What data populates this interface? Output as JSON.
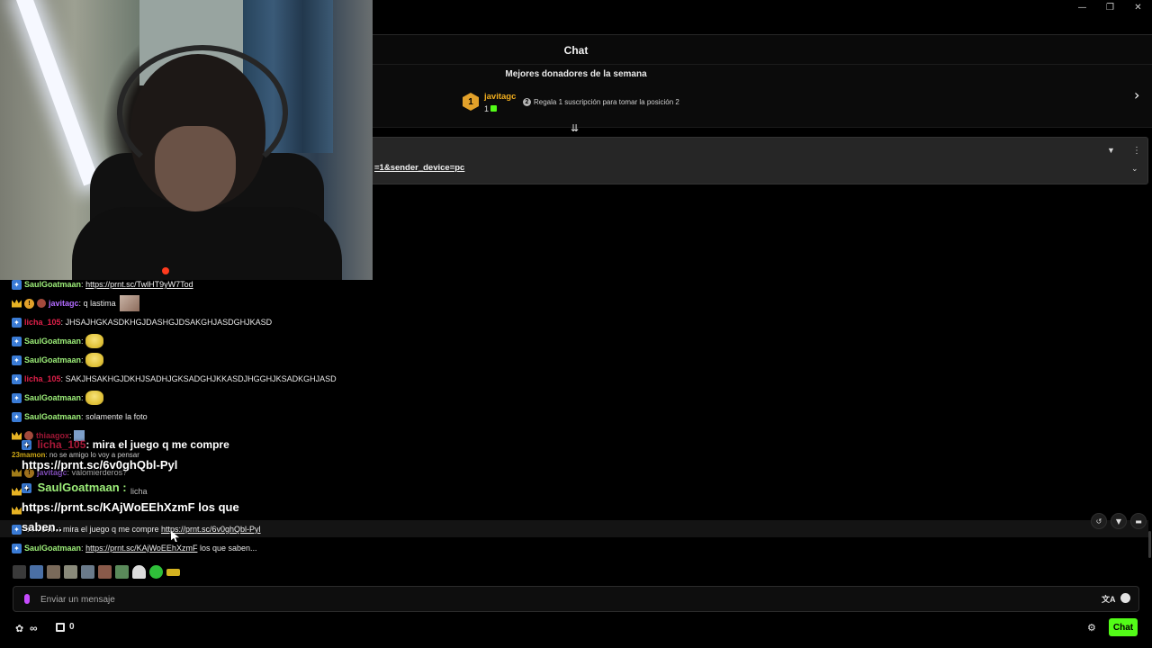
{
  "window": {
    "minimize": "—",
    "restore": "❐",
    "close": "✕"
  },
  "header": {
    "title": "Chat"
  },
  "donors": {
    "title": "Mejores donadores de la semana",
    "top": {
      "rank": "1",
      "name": "javitagc",
      "count": "1"
    },
    "cta_icon": "2",
    "cta": "Regala 1 suscripción para tomar la posición 2"
  },
  "pinned": {
    "link": "=1&sender_device=pc"
  },
  "messages": [
    {
      "user": "SaulGoatmaan",
      "sep": ":",
      "link": "https://prnt.sc/TwlHT9yW7Tod"
    },
    {
      "user": "javitagc",
      "sep": ":",
      "text": "q lastima"
    },
    {
      "user": "licha_105",
      "sep": ":",
      "text": "JHSAJHGKASDKHGJDASHGJDSAKGHJASDGHJKASD"
    },
    {
      "user": "SaulGoatmaan",
      "sep": ":"
    },
    {
      "user": "SaulGoatmaan",
      "sep": ":"
    },
    {
      "user": "licha_105",
      "sep": ":",
      "text": "SAKJHSAKHGJDKHJSADHJGKSADGHJKKASDJHGGHJKSADKGHJASD"
    },
    {
      "user": "SaulGoatmaan",
      "sep": ":"
    },
    {
      "user": "SaulGoatmaan",
      "sep": ":",
      "text": "solamente la foto"
    },
    {
      "user": "thiaagox",
      "sep": ":"
    },
    {
      "user": "23mamon",
      "sep": ":",
      "text": "no se amigo lo voy a pensar"
    },
    {
      "user": "javitagc",
      "sep": ":",
      "text": "valomierderos?"
    },
    {
      "user": "",
      "sep": "",
      "text": "licha"
    },
    {
      "user": "saben..",
      "sep": ":",
      "text": "mira el juego q me compre",
      "link": "https://prnt.sc/6v0ghQbl-Pyl"
    },
    {
      "user": "SaulGoatmaan",
      "sep": ":",
      "link": "https://prnt.sc/KAjWoEEhXzmF",
      "text": "los que saben..."
    }
  ],
  "overlay": {
    "line1_user": "licha_105",
    "line1_text": ": mira el juego q me compre",
    "line2": "https://prnt.sc/6v0ghQbl-Pyl",
    "line3": "SaulGoatmaan :",
    "line4": "https://prnt.sc/KAjWoEEhXzmF los que",
    "line5": "saben.."
  },
  "input": {
    "placeholder": "Enviar un mensaje"
  },
  "footer": {
    "points": "∞",
    "gifts": "0",
    "chat_button": "Chat"
  },
  "colors": {
    "accent": "#53fc18",
    "gold": "#e2a12a"
  }
}
